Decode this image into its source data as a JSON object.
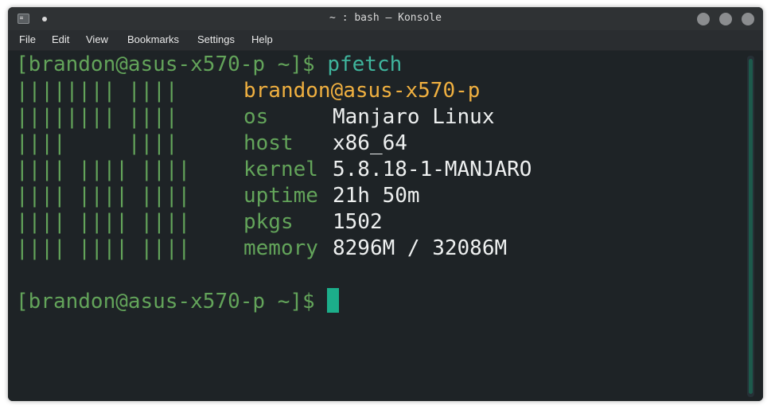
{
  "window": {
    "title": "~ : bash — Konsole",
    "icons": [
      "terminal-app-icon",
      "pin-dot-icon",
      "minimize-icon",
      "maximize-icon",
      "close-icon"
    ]
  },
  "menu": {
    "items": [
      "File",
      "Edit",
      "View",
      "Bookmarks",
      "Settings",
      "Help"
    ]
  },
  "terminal": {
    "prompt": "[brandon@asus-x570-p ~]$",
    "command": "pfetch",
    "logo": [
      "|||||||| ||||",
      "|||||||| ||||",
      "||||     ||||",
      "|||| |||| ||||",
      "|||| |||| ||||",
      "|||| |||| ||||",
      "|||| |||| ||||"
    ],
    "user_host": "brandon@asus-x570-p",
    "info": [
      {
        "key": "os",
        "value": "Manjaro Linux"
      },
      {
        "key": "host",
        "value": "x86_64"
      },
      {
        "key": "kernel",
        "value": "5.8.18-1-MANJARO"
      },
      {
        "key": "uptime",
        "value": "21h 50m"
      },
      {
        "key": "pkgs",
        "value": "1502"
      },
      {
        "key": "memory",
        "value": "8296M / 32086M"
      }
    ],
    "prompt2": "[brandon@asus-x570-p ~]$"
  },
  "colors": {
    "background": "#1e2326",
    "prompt_green": "#63a45a",
    "command_teal": "#3fb49c",
    "userhost_orange": "#f0b040",
    "cursor": "#1cae8a"
  }
}
